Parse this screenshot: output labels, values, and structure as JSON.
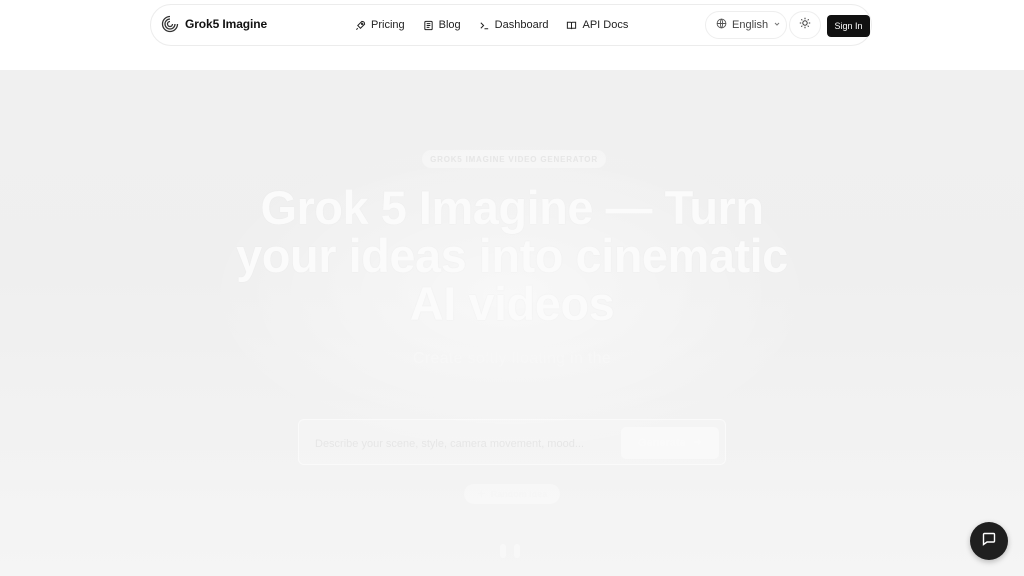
{
  "header": {
    "brand_name": "Grok5 Imagine",
    "brand_icon": "swirl-logo-icon",
    "nav": [
      {
        "label": "Pricing",
        "icon": "rocket-icon"
      },
      {
        "label": "Blog",
        "icon": "newspaper-icon"
      },
      {
        "label": "Dashboard",
        "icon": "terminal-icon"
      },
      {
        "label": "API Docs",
        "icon": "book-icon"
      }
    ],
    "language": "English",
    "theme_icon": "sun-icon",
    "sign_in_label": "Sign In"
  },
  "hero": {
    "badge": "GROK5 IMAGINE VIDEO GENERATOR",
    "headline_lines": [
      "Grok 5 Imagine — Turn",
      "your ideas into cinematic",
      "AI videos"
    ],
    "subtitle": "Create softly floating in the",
    "prompt_placeholder": "Describe your scene, style, camera movement, mood...",
    "generate_label": "Generate",
    "random_label": "Random idea"
  },
  "colors": {
    "accent": "#111111",
    "hero_bg": "#f0f0f0"
  }
}
